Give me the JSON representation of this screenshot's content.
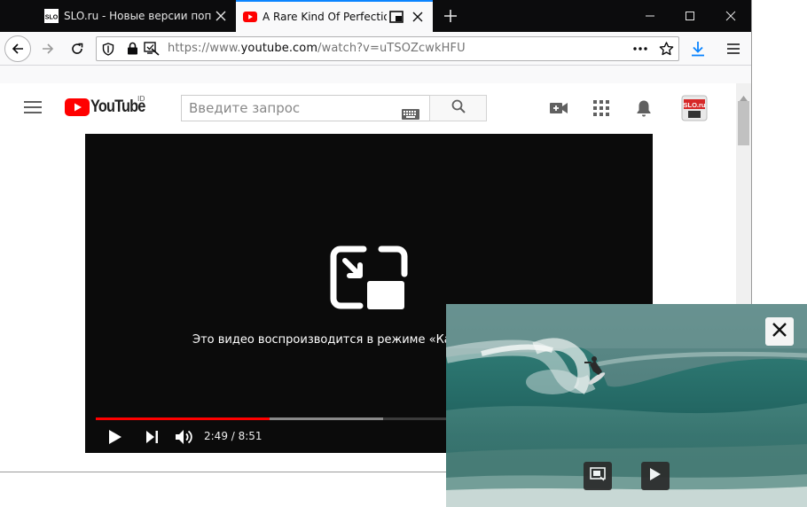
{
  "colors": {
    "tab_accent": "#0a84ff",
    "youtube_red": "#ff0000",
    "progress_red": "#ff0000",
    "download_blue": "#0a84ff"
  },
  "tabs": [
    {
      "title": "SLO.ru - Новые версии попул",
      "favicon": "slo-icon",
      "favicon_text": "SLO",
      "close_icon": "close-icon"
    },
    {
      "title": "A Rare Kind Of Perfection -  ",
      "favicon": "youtube-icon",
      "pip_icon": "picture-in-picture-icon",
      "close_icon": "close-icon",
      "active": true
    }
  ],
  "window_controls": {
    "minimize": "minimize-icon",
    "maximize": "maximize-icon",
    "close": "close-icon"
  },
  "toolbar": {
    "back": "back-arrow-icon",
    "forward": "forward-arrow-icon",
    "reload": "reload-icon",
    "url_prefix": "https://www.",
    "url_domain": "youtube.com",
    "url_suffix": "/watch?v=uTSOZcwkHFU",
    "page_actions": "more-dots-icon",
    "bookmark": "star-icon",
    "downloads": "download-arrow-icon",
    "menu": "hamburger-menu-icon"
  },
  "youtube": {
    "logo_text": "YouTube",
    "region": "ID",
    "search_placeholder": "Введите запрос",
    "avatar_text": "SLO.ru"
  },
  "player": {
    "pip_message": "Это видео воспроизводится в режиме «Карт",
    "current_time": "2:49",
    "separator": " / ",
    "duration": "8:51",
    "time_text": "2:49 / 8:51",
    "played_fraction": 0.318,
    "loaded_fraction": 0.526
  },
  "pip_window": {
    "close_icon": "close-icon",
    "back_to_tab_icon": "back-to-tab-icon",
    "play_icon": "play-icon"
  }
}
